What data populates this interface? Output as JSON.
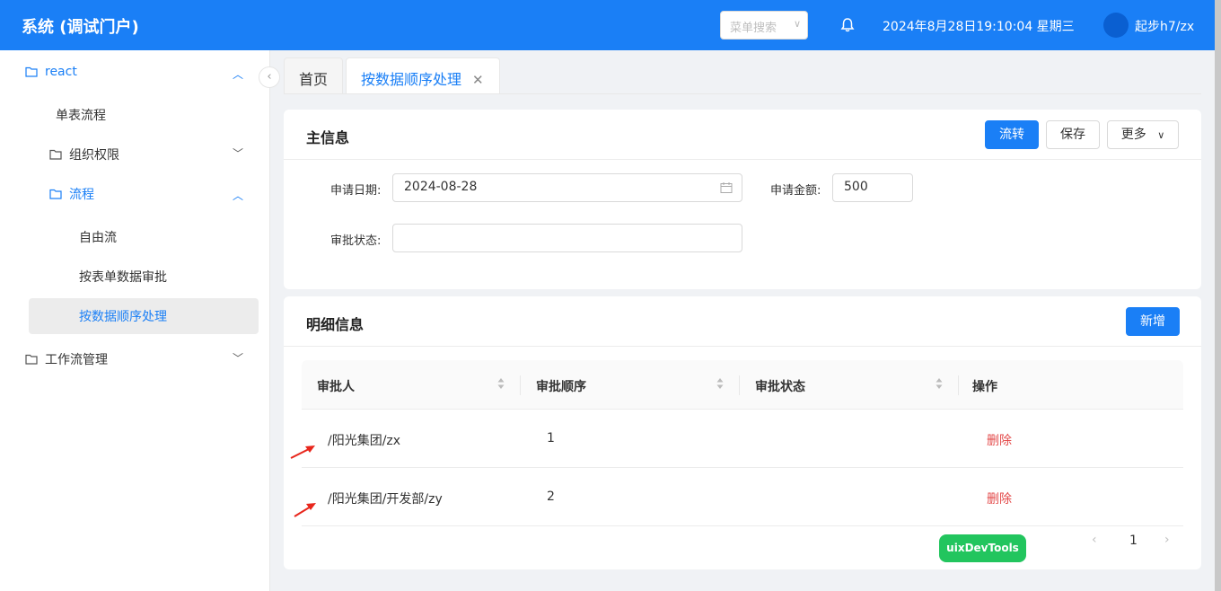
{
  "header": {
    "title": "系统 (调试门户)",
    "menu_search_placeholder": "菜单搜索",
    "datetime": "2024年8月28日19:10:04 星期三",
    "username": "起步h7/zx",
    "brand_color": "#1a7ff6"
  },
  "sidebar": {
    "items": [
      {
        "label": "react",
        "icon": "folder-icon",
        "state": "expanded"
      },
      {
        "label": "单表流程"
      },
      {
        "label": "组织权限",
        "icon": "folder-icon",
        "state": "collapsed"
      },
      {
        "label": "流程",
        "icon": "folder-icon",
        "state": "expanded"
      },
      {
        "label": "自由流"
      },
      {
        "label": "按表单数据审批"
      },
      {
        "label": "按数据顺序处理",
        "active": true
      },
      {
        "label": "工作流管理",
        "icon": "folder-icon",
        "state": "collapsed"
      }
    ]
  },
  "tabs": [
    {
      "label": "首页"
    },
    {
      "label": "按数据顺序处理",
      "active": true
    }
  ],
  "main_card": {
    "title": "主信息",
    "buttons": {
      "transfer": "流转",
      "save": "保存",
      "more": "更多"
    },
    "fields": {
      "apply_date_label": "申请日期:",
      "apply_date_value": "2024-08-28",
      "apply_amount_label": "申请金额:",
      "apply_amount_value": "500",
      "approve_status_label": "审批状态:",
      "approve_status_value": ""
    }
  },
  "detail_card": {
    "title": "明细信息",
    "add_button": "新增",
    "columns": [
      "审批人",
      "审批顺序",
      "审批状态",
      "操作"
    ],
    "rows": [
      {
        "approver": "/阳光集团/zx",
        "order": "1",
        "status": "",
        "action": "删除"
      },
      {
        "approver": "/阳光集团/开发部/zy",
        "order": "2",
        "status": "",
        "action": "删除"
      }
    ],
    "pagination": {
      "current_page": "1"
    }
  },
  "devtools_badge": "uixDevTools"
}
